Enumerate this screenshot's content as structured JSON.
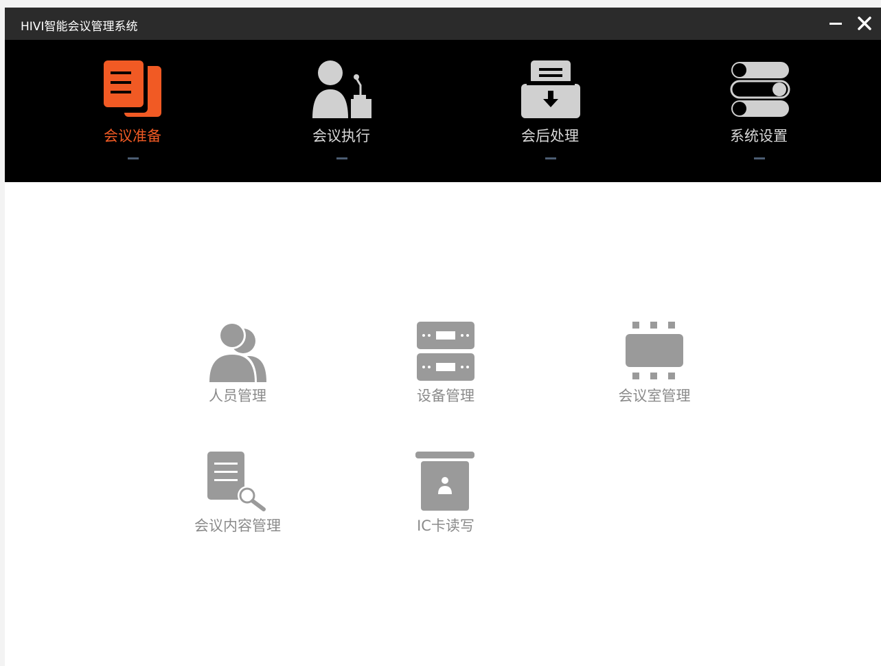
{
  "window": {
    "title": "HIVI智能会议管理系统",
    "minimize_icon": "minimize-icon",
    "close_icon": "close-icon"
  },
  "nav": {
    "active_index": 0,
    "active_color": "#f15a24",
    "items": [
      {
        "label": "会议准备",
        "icon": "documents-icon"
      },
      {
        "label": "会议执行",
        "icon": "speaker-podium-icon"
      },
      {
        "label": "会后处理",
        "icon": "archive-download-icon"
      },
      {
        "label": "系统设置",
        "icon": "toggles-icon"
      }
    ]
  },
  "tiles": [
    {
      "label": "人员管理",
      "icon": "users-icon"
    },
    {
      "label": "设备管理",
      "icon": "server-icon"
    },
    {
      "label": "会议室管理",
      "icon": "chip-icon"
    },
    {
      "label": "会议内容管理",
      "icon": "document-search-icon"
    },
    {
      "label": "IC卡读写",
      "icon": "id-card-icon"
    }
  ]
}
